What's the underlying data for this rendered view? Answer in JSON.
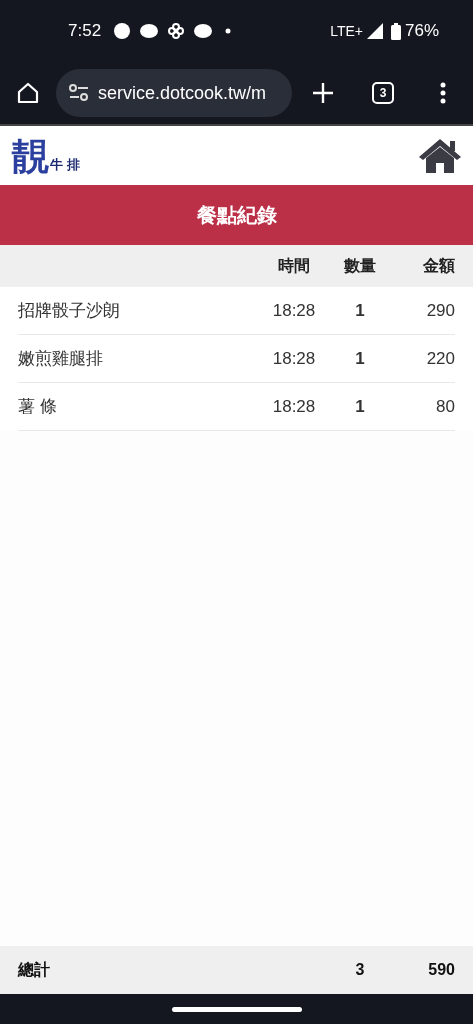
{
  "status_bar": {
    "time": "7:52",
    "network": "LTE+",
    "battery": "76%"
  },
  "browser": {
    "url": "service.dotcook.tw/m",
    "tab_count": "3"
  },
  "site_header": {
    "logo_char": "靚",
    "logo_text": "牛 排"
  },
  "title": "餐點紀錄",
  "table": {
    "columns": [
      "",
      "時間",
      "數量",
      "金額"
    ],
    "rows": [
      [
        "招牌骰子沙朗",
        "18:28",
        "1",
        "290"
      ],
      [
        "嫩煎雞腿排",
        "18:28",
        "1",
        "220"
      ],
      [
        "薯 條",
        "18:28",
        "1",
        "80"
      ]
    ]
  },
  "total": {
    "label": "總計",
    "quantity": "3",
    "amount": "590"
  }
}
